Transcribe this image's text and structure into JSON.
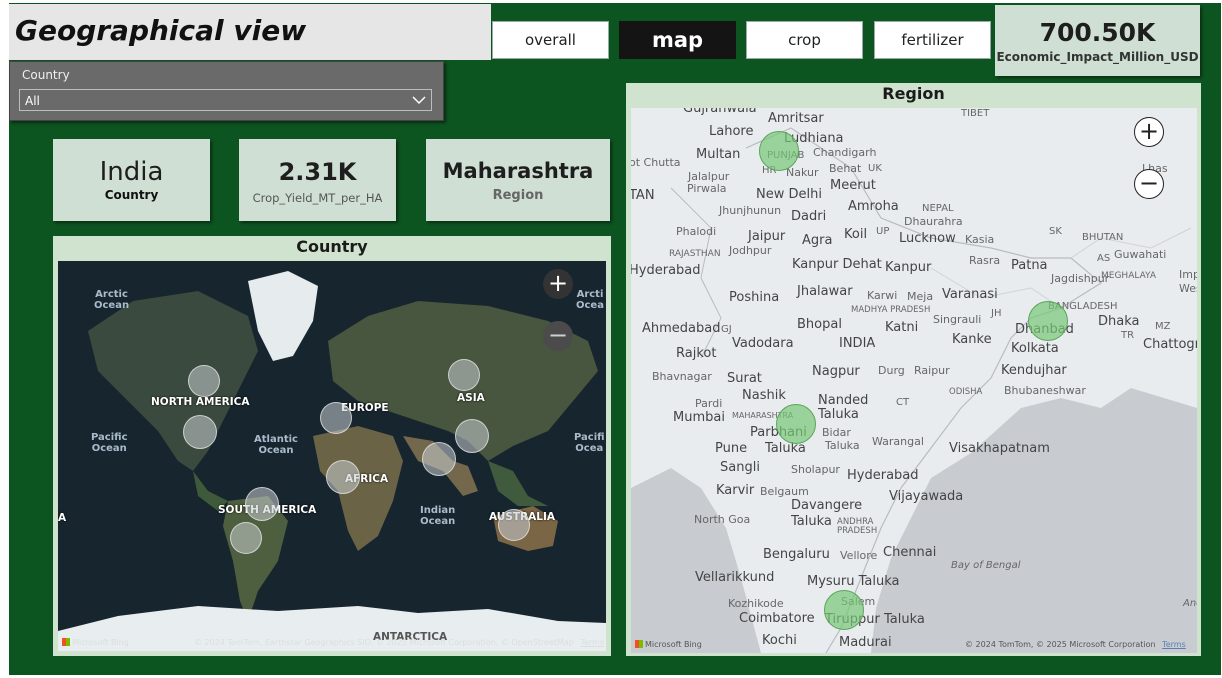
{
  "page": {
    "title": "Geographical view"
  },
  "slicer": {
    "label": "Country",
    "selected": "All"
  },
  "nav": {
    "buttons": [
      {
        "label": "overall",
        "active": false
      },
      {
        "label": "map",
        "active": true
      },
      {
        "label": "crop",
        "active": false
      },
      {
        "label": "fertilizer",
        "active": false
      }
    ]
  },
  "kpis": {
    "economic": {
      "value": "700.50K",
      "label": "Economic_Impact_Million_USD"
    },
    "country": {
      "value": "India",
      "label": "Country"
    },
    "yield": {
      "value": "2.31K",
      "label": "Crop_Yield_MT_per_HA"
    },
    "region": {
      "value": "Maharashtra",
      "label": "Region"
    }
  },
  "country_map": {
    "title": "Country",
    "labels": {
      "arctic_w": "Arctic\nOcean",
      "arctic_e": "Arcti\nOcea",
      "north_america": "NORTH AMERICA",
      "europe": "EUROPE",
      "asia": "ASIA",
      "pacific_w": "Pacific\nOcean",
      "atlantic": "Atlantic\nOcean",
      "pacific_e": "Pacifi\nOcea",
      "africa": "AFRICA",
      "a_edge": "A",
      "south_america": "SOUTH AMERICA",
      "indian": "Indian\nOcean",
      "australia": "AUSTRALIA",
      "antarctica": "ANTARCTICA"
    },
    "zoom_in": "+",
    "zoom_out": "−",
    "provider": "Microsoft Bing",
    "copyright": "© 2024 TomTom, Earthstar Geographics SIO, © 2025 Microsoft Corporation, © OpenStreetMap",
    "terms": "Terms"
  },
  "region_map": {
    "title": "Region",
    "labels": {
      "gujranwala": "Gujranwala",
      "amritsar": "Amritsar",
      "tibet": "TIBET",
      "lahore": "Lahore",
      "ludhiana": "Ludhiana",
      "punjab": "PUNJAB",
      "chandigarh": "Chandigarh",
      "hr": "HR",
      "multan": "Multan",
      "nakur": "Nakur",
      "behat": "Behat",
      "uk": "UK",
      "jalalpur": "Jalalpur",
      "pirwala": "Pirwala",
      "chutta": "ot Chutta",
      "lhasa": "Lhas",
      "newdelhi": "New Delhi",
      "meerut": "Meerut",
      "tan": "TAN",
      "jhunjhunun": "Jhunjhunun",
      "nepal": "NEPAL",
      "dadri": "Dadri",
      "amroha": "Amroha",
      "dhaurahra": "Dhaurahra",
      "phalodi": "Phalodi",
      "jaipur": "Jaipur",
      "agra": "Agra",
      "koil": "Koil",
      "up": "UP",
      "lucknow": "Lucknow",
      "kasia": "Kasia",
      "sk": "SK",
      "bhutan": "BHUTAN",
      "rajasthan": "RAJASTHAN",
      "jodhpur": "Jodhpur",
      "as": "AS",
      "guwahati": "Guwahati",
      "hyderabad_pk": "Hyderabad",
      "kanpurdehat": "Kanpur Dehat",
      "kanpur": "Kanpur",
      "rasra": "Rasra",
      "patna": "Patna",
      "jagdishpur": "Jagdishpur",
      "meghalaya": "MEGHALAYA",
      "imp": "Imp",
      "wes": "Wes",
      "poshina": "Poshina",
      "jhalawar": "Jhalawar",
      "karwi": "Karwi",
      "meja": "Meja",
      "varanasi": "Varanasi",
      "bangladesh": "BANGLADESH",
      "madhyapradesh": "MADHYA PRADESH",
      "singrauli": "Singrauli",
      "jh": "JH",
      "ahmedabad": "Ahmedabad",
      "gj": "GJ",
      "bhopal": "Bhopal",
      "katni": "Katni",
      "dhanbad": "Dhanbad",
      "dhaka": "Dhaka",
      "mz": "MZ",
      "vadodara": "Vadodara",
      "india": "INDIA",
      "kanke": "Kanke",
      "kolkata": "Kolkata",
      "tr": "TR",
      "chattogram": "Chattogram",
      "rajkot": "Rajkot",
      "bhavnagar": "Bhavnagar",
      "nagpur": "Nagpur",
      "durg": "Durg",
      "raipur": "Raipur",
      "kendujhar": "Kendujhar",
      "surat": "Surat",
      "odisha": "ODISHA",
      "bhubaneswar": "Bhubaneshwar",
      "nashik": "Nashik",
      "nanded": "Nanded",
      "pardi": "Pardi",
      "ct": "CT",
      "maharashtra": "MAHARASHTRA",
      "mumbai": "Mumbai",
      "taluka1": "Taluka",
      "bidar": "Bidar",
      "parbhani": "Parbhani",
      "taluka2": "Taluka",
      "warangal": "Warangal",
      "pune": "Pune",
      "taluka3": "Taluka",
      "visakhapatnam": "Visakhapatnam",
      "sangli": "Sangli",
      "sholapur": "Sholapur",
      "hyderabad": "Hyderabad",
      "karvir": "Karvir",
      "belgaum": "Belgaum",
      "vijayawada": "Vijayawada",
      "davangere": "Davangere",
      "northgoa": "North Goa",
      "taluka4": "Taluka",
      "andhrapradesh": "ANDHRA\nPRADESH",
      "bengaluru": "Bengaluru",
      "vellore": "Vellore",
      "chennai": "Chennai",
      "bayofbengal": "Bay of Bengal",
      "vellarikkund": "Vellarikkund",
      "mysuru": "Mysuru Taluka",
      "kozhikode": "Kozhikode",
      "salem": "Salem",
      "anda": "Anda",
      "coimbatore": "Coimbatore",
      "tiruppur": "Tiruppur Taluka",
      "kochi": "Kochi",
      "madurai": "Madurai"
    },
    "zoom_in": "+",
    "zoom_out": "−",
    "provider": "Microsoft Bing",
    "copyright": "© 2024 TomTom, © 2025 Microsoft Corporation",
    "terms": "Terms"
  }
}
